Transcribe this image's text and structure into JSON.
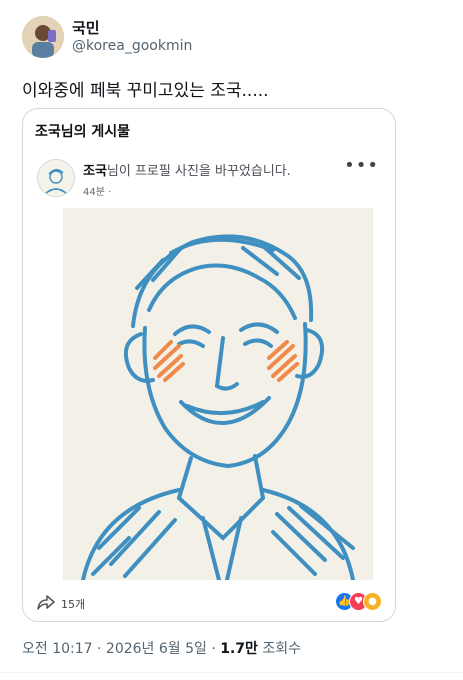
{
  "user": {
    "name": "국민",
    "handle": "@korea_gookmin"
  },
  "tweet": {
    "text": "이와중에 페북 꾸미고있는 조국....."
  },
  "card": {
    "title": "조국님의 게시물",
    "post_name": "조국",
    "post_action": "님이 프로필 사진을 바꾸었습니다.",
    "post_time": "44분 ·",
    "more_glyph": "•••",
    "share_count": "15개",
    "reaction_icons": [
      "like-icon",
      "love-icon",
      "care-icon"
    ]
  },
  "meta": {
    "time": "오전 10:17 · 2026년 6월 5일 · ",
    "views_count": "1.7만",
    "views_label": " 조회수"
  },
  "colors": {
    "sketch_blue": "#3f8fc0",
    "cheek": "#f08a4b",
    "like": "#1877f2",
    "love": "#f33e58",
    "care": "#f7b125"
  }
}
